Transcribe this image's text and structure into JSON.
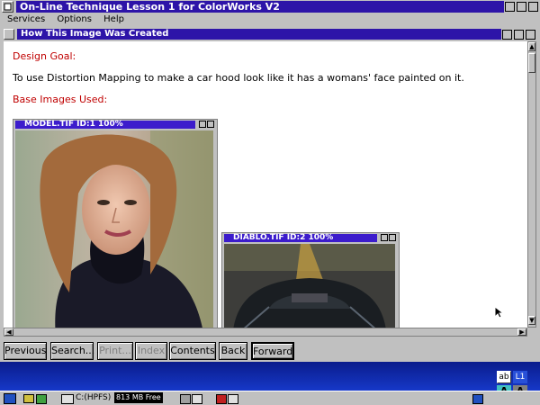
{
  "app": {
    "title": "On-Line Technique Lesson 1 for ColorWorks V2",
    "menu": [
      "Services",
      "Options",
      "Help"
    ]
  },
  "doc_window": {
    "title": "How This Image Was Created"
  },
  "content": {
    "design_goal_heading": "Design Goal:",
    "design_goal_text": "To use Distortion Mapping to make a car hood look like it has a womans' face painted on it.",
    "base_images_heading": "Base Images Used:"
  },
  "images": [
    {
      "title": "MODEL.TIF ID:1  100%",
      "depicts": "portrait of woman in black turtleneck"
    },
    {
      "title": "DIABLO.TIF ID:2  100%",
      "depicts": "black sports car hood on road"
    }
  ],
  "nav_buttons": [
    {
      "label": "Previous",
      "enabled": true
    },
    {
      "label": "Search...",
      "enabled": true
    },
    {
      "label": "Print...",
      "enabled": false
    },
    {
      "label": "Index",
      "enabled": false
    },
    {
      "label": "Contents",
      "enabled": true
    },
    {
      "label": "Back",
      "enabled": true
    },
    {
      "label": "Forward",
      "enabled": true
    }
  ],
  "taskbar": {
    "drive_label": "C:(HPFS)",
    "free_space": "813 MB Free"
  },
  "colors": {
    "titlebar": "#2d14a8",
    "desktop": "#0c28b0",
    "heading": "#c00000"
  }
}
